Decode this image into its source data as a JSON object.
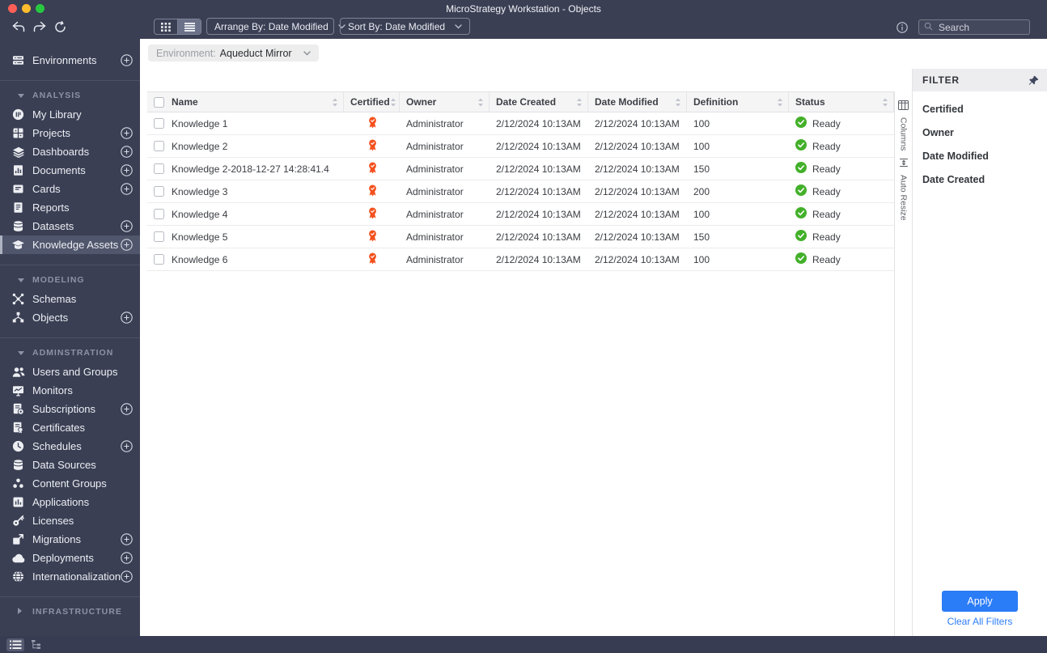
{
  "window": {
    "title": "MicroStrategy Workstation - Objects"
  },
  "toolbar": {
    "view_toggle": [
      {
        "icon": "grid-view-icon",
        "selected": false
      },
      {
        "icon": "list-view-icon",
        "selected": true
      }
    ],
    "arrange_by": {
      "label": "Arrange By:",
      "value": "Date Modified"
    },
    "sort_by": {
      "label": "Sort By:",
      "value": "Date Modified"
    },
    "info_icon": "info-icon",
    "search": {
      "placeholder": "Search",
      "icon": "search-icon"
    }
  },
  "environment_bar": {
    "label": "Environment:",
    "value": "Aqueduct Mirror"
  },
  "sidebar": {
    "sections": [
      {
        "header": null,
        "items": [
          {
            "label": "Environments",
            "icon": "environments-icon",
            "plus": true
          }
        ]
      },
      {
        "header": "ANALYSIS",
        "collapsed": false,
        "items": [
          {
            "label": "My Library",
            "icon": "my-library-icon",
            "plus": false
          },
          {
            "label": "Projects",
            "icon": "projects-icon",
            "plus": true
          },
          {
            "label": "Dashboards",
            "icon": "dashboards-icon",
            "plus": true
          },
          {
            "label": "Documents",
            "icon": "documents-icon",
            "plus": true
          },
          {
            "label": "Cards",
            "icon": "cards-icon",
            "plus": true
          },
          {
            "label": "Reports",
            "icon": "reports-icon",
            "plus": false
          },
          {
            "label": "Datasets",
            "icon": "datasets-icon",
            "plus": true
          },
          {
            "label": "Knowledge Assets",
            "icon": "knowledge-assets-icon",
            "plus": true,
            "selected": true
          }
        ]
      },
      {
        "header": "MODELING",
        "collapsed": false,
        "items": [
          {
            "label": "Schemas",
            "icon": "schemas-icon",
            "plus": false
          },
          {
            "label": "Objects",
            "icon": "objects-icon",
            "plus": true
          }
        ]
      },
      {
        "header": "ADMINSTRATION",
        "collapsed": false,
        "items": [
          {
            "label": "Users and Groups",
            "icon": "users-and-groups-icon",
            "plus": false
          },
          {
            "label": "Monitors",
            "icon": "monitors-icon",
            "plus": false
          },
          {
            "label": "Subscriptions",
            "icon": "subscriptions-icon",
            "plus": true
          },
          {
            "label": "Certificates",
            "icon": "certificates-icon",
            "plus": false
          },
          {
            "label": "Schedules",
            "icon": "schedules-icon",
            "plus": true
          },
          {
            "label": "Data Sources",
            "icon": "data-sources-icon",
            "plus": false
          },
          {
            "label": "Content Groups",
            "icon": "content-groups-icon",
            "plus": false
          },
          {
            "label": "Applications",
            "icon": "applications-icon",
            "plus": false
          },
          {
            "label": "Licenses",
            "icon": "licenses-icon",
            "plus": false
          },
          {
            "label": "Migrations",
            "icon": "migrations-icon",
            "plus": true
          },
          {
            "label": "Deployments",
            "icon": "deployments-icon",
            "plus": true
          },
          {
            "label": "Internationalization",
            "icon": "internationalization-icon",
            "plus": true
          }
        ]
      },
      {
        "header": "INFRASTRUCTURE",
        "collapsed": true,
        "items": []
      }
    ]
  },
  "table": {
    "columns": [
      {
        "key": "name",
        "label": "Name",
        "sortable": true
      },
      {
        "key": "certified",
        "label": "Certified",
        "sortable": true
      },
      {
        "key": "owner",
        "label": "Owner",
        "sortable": true
      },
      {
        "key": "date_created",
        "label": "Date Created",
        "sortable": true
      },
      {
        "key": "date_modified",
        "label": "Date Modified",
        "sortable": true
      },
      {
        "key": "definition",
        "label": "Definition",
        "sortable": true
      },
      {
        "key": "status",
        "label": "Status",
        "sortable": true
      }
    ],
    "rows": [
      {
        "name": "Knowledge 1",
        "certified": true,
        "owner": "Administrator",
        "date_created": "2/12/2024 10:13AM",
        "date_modified": "2/12/2024 10:13AM",
        "definition": "100",
        "status": "Ready"
      },
      {
        "name": "Knowledge 2",
        "certified": true,
        "owner": "Administrator",
        "date_created": "2/12/2024 10:13AM",
        "date_modified": "2/12/2024 10:13AM",
        "definition": "100",
        "status": "Ready"
      },
      {
        "name": "Knowledge 2-2018-12-27 14:28:41.4",
        "certified": true,
        "owner": "Administrator",
        "date_created": "2/12/2024 10:13AM",
        "date_modified": "2/12/2024 10:13AM",
        "definition": "150",
        "status": "Ready"
      },
      {
        "name": "Knowledge 3",
        "certified": true,
        "owner": "Administrator",
        "date_created": "2/12/2024 10:13AM",
        "date_modified": "2/12/2024 10:13AM",
        "definition": "200",
        "status": "Ready"
      },
      {
        "name": "Knowledge 4",
        "certified": true,
        "owner": "Administrator",
        "date_created": "2/12/2024 10:13AM",
        "date_modified": "2/12/2024 10:13AM",
        "definition": "100",
        "status": "Ready"
      },
      {
        "name": "Knowledge 5",
        "certified": true,
        "owner": "Administrator",
        "date_created": "2/12/2024 10:13AM",
        "date_modified": "2/12/2024 10:13AM",
        "definition": "150",
        "status": "Ready"
      },
      {
        "name": "Knowledge 6",
        "certified": true,
        "owner": "Administrator",
        "date_created": "2/12/2024 10:13AM",
        "date_modified": "2/12/2024 10:13AM",
        "definition": "100",
        "status": "Ready"
      }
    ],
    "certified_icon": "certified-badge-icon",
    "status_icon": "status-ready-icon"
  },
  "side_strip": {
    "columns_icon": "columns-icon",
    "columns_label": "Columns",
    "auto_resize_icon": "auto-resize-icon",
    "auto_resize_label": "Auto Resize"
  },
  "filter": {
    "title": "FILTER",
    "pin_icon": "pin-icon",
    "items": [
      "Certified",
      "Owner",
      "Date Modified",
      "Date Created"
    ],
    "apply_label": "Apply",
    "clear_label": "Clear All Filters"
  },
  "status_bar": {
    "icons": [
      {
        "icon": "list-view-icon",
        "selected": true
      },
      {
        "icon": "tree-view-icon",
        "selected": false
      }
    ]
  },
  "colors": {
    "topbar": "#3a3f54",
    "selected_item": "#50566c",
    "accent_blue": "#2b7cf7",
    "certified_orange": "#f4511e",
    "status_green": "#43b02a"
  }
}
